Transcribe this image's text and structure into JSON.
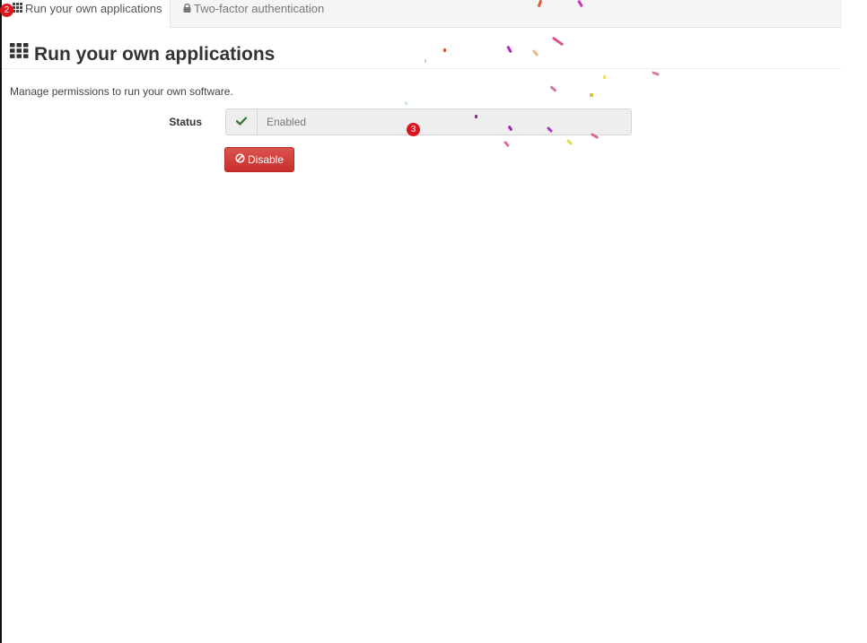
{
  "tabs": [
    {
      "label": "Run your own applications",
      "icon": "grid-icon",
      "active": true,
      "marker": "2"
    },
    {
      "label": "Two-factor authentication",
      "icon": "lock-icon",
      "active": false
    }
  ],
  "page": {
    "title": "Run your own applications",
    "title_icon": "grid-icon",
    "description": "Manage permissions to run your own software."
  },
  "status": {
    "label": "Status",
    "value": "Enabled",
    "icon": "check-icon",
    "marker": "3"
  },
  "disable_button": {
    "label": "Disable",
    "icon": "ban-icon"
  },
  "colors": {
    "danger": "#d9534f",
    "success": "#3c763d",
    "marker": "#e0141b"
  }
}
